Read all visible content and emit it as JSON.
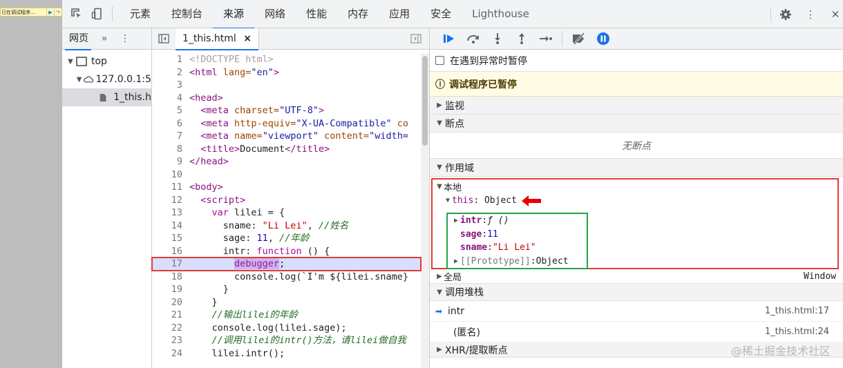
{
  "browser": {
    "paused_chip_text": "已在调试程序..."
  },
  "toolbar": {
    "tabs": [
      "元素",
      "控制台",
      "来源",
      "网络",
      "性能",
      "内存",
      "应用",
      "安全",
      "Lighthouse"
    ],
    "active_tab": "来源",
    "icons": [
      "inspect-icon",
      "device-toggle-icon",
      "settings-icon",
      "more-icon",
      "close-icon"
    ]
  },
  "navigator": {
    "tab_label": "网页",
    "more_label": "»",
    "tree": [
      {
        "label": "top"
      },
      {
        "label": "127.0.0.1:5"
      },
      {
        "label": "1_this.h"
      }
    ]
  },
  "editor": {
    "file_tab": "1_this.html",
    "close_glyph": "×",
    "execution_line": 17,
    "lines": [
      {
        "n": "1"
      },
      {
        "n": "2"
      },
      {
        "n": "3"
      },
      {
        "n": "4"
      },
      {
        "n": "5"
      },
      {
        "n": "6"
      },
      {
        "n": "7"
      },
      {
        "n": "8"
      },
      {
        "n": "9"
      },
      {
        "n": "10"
      },
      {
        "n": "11"
      },
      {
        "n": "12"
      },
      {
        "n": "13"
      },
      {
        "n": "14"
      },
      {
        "n": "15"
      },
      {
        "n": "16"
      },
      {
        "n": "17"
      },
      {
        "n": "18"
      },
      {
        "n": "19"
      },
      {
        "n": "20"
      },
      {
        "n": "21"
      },
      {
        "n": "22"
      },
      {
        "n": "23"
      },
      {
        "n": "24"
      }
    ],
    "code": {
      "l1": "<!DOCTYPE html>",
      "l2_tag": "<html",
      "l2_attr": " lang=",
      "l2_val": "\"en\"",
      "l2_end": ">",
      "l4": "<head>",
      "l5_tag": "  <meta",
      "l5_attr": " charset=",
      "l5_val": "\"UTF-8\"",
      "l5_end": ">",
      "l6_tag": "  <meta",
      "l6_attr": " http-equiv=",
      "l6_val": "\"X-UA-Compatible\"",
      "l6_rest": " co",
      "l7_tag": "  <meta",
      "l7_attr": " name=",
      "l7_val": "\"viewport\"",
      "l7_attr2": " content=",
      "l7_rest": "\"width=",
      "l8_tag": "  <title>",
      "l8_text": "Document",
      "l8_end": "</title>",
      "l9": "</head>",
      "l11": "<body>",
      "l12": "  <script>",
      "l13_kw": "    var",
      "l13_rest": " lilei = {",
      "l14_a": "      sname: ",
      "l14_b": "\"Li Lei\"",
      "l14_c": ", ",
      "l14_com": "//姓名",
      "l15_a": "      sage: ",
      "l15_b": "11",
      "l15_c": ", ",
      "l15_com": "//年龄",
      "l16_a": "      intr: ",
      "l16_kw": "function",
      "l16_c": " () {",
      "l17_pad": "        ",
      "l17_kw": "debugger",
      "l17_end": ";",
      "l18": "        console.log(`I'm ${lilei.sname}",
      "l19": "      }",
      "l20": "    }",
      "l21": "    //输出lilei的年龄",
      "l22": "    console.log(lilei.sage);",
      "l23": "    //调用lilei的intr()方法，请lilei做自我",
      "l24": "    lilei.intr();"
    }
  },
  "debugger": {
    "controls": [
      "resume-icon",
      "step-over-icon",
      "step-into-icon",
      "step-out-icon",
      "step-icon",
      "deactivate-breakpoints-icon",
      "pause-on-exceptions-icon"
    ],
    "pause_on_exceptions": "在遇到异常时暂停",
    "paused_banner": "调试程序已暂停",
    "watch": "监视",
    "breakpoints": "断点",
    "no_breakpoints": "无断点",
    "scope": "作用域",
    "local": "本地",
    "this_label": "this",
    "this_value": "Object",
    "props": [
      {
        "name": "intr",
        "sep": ": ",
        "value": "ƒ ()",
        "expandable": true
      },
      {
        "name": "sage",
        "sep": ": ",
        "value": "11",
        "expandable": false
      },
      {
        "name": "sname",
        "sep": ": ",
        "value": "\"Li Lei\"",
        "expandable": false
      },
      {
        "name": "[[Prototype]]",
        "sep": ": ",
        "value": "Object",
        "expandable": true
      }
    ],
    "global": "全局",
    "global_value": "Window",
    "call_stack": "调用堆栈",
    "frames": [
      {
        "name": "intr",
        "location": "1_this.html:17",
        "current": true
      },
      {
        "name": "(匿名)",
        "location": "1_this.html:24",
        "current": false
      }
    ],
    "xhr": "XHR/提取断点"
  },
  "watermark": "@稀土掘金技术社区",
  "colors": {
    "accent": "#1a73e8",
    "highlight_box": "#e53935",
    "props_box": "#22a447",
    "exec_line": "#d7deff"
  }
}
